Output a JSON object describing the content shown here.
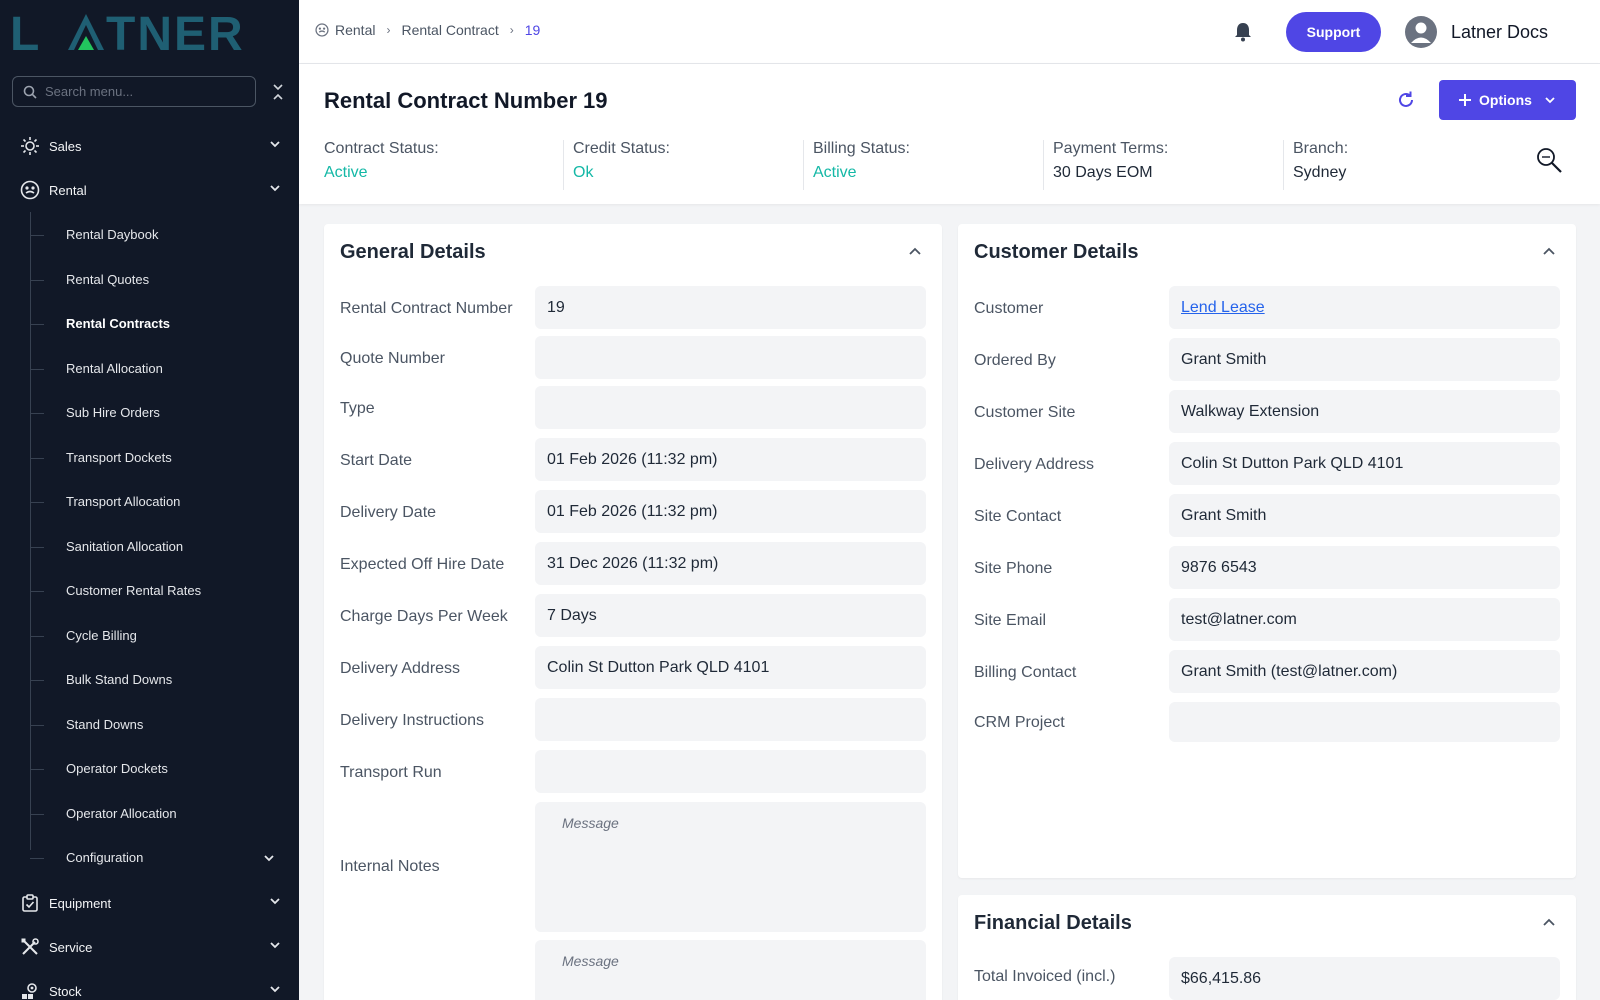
{
  "sidebar": {
    "logo_text": "LATNER",
    "search_placeholder": "Search menu...",
    "sections": {
      "sales": "Sales",
      "rental": "Rental",
      "equipment": "Equipment",
      "service": "Service",
      "stock": "Stock"
    },
    "rental_items": [
      "Rental Daybook",
      "Rental Quotes",
      "Rental Contracts",
      "Rental Allocation",
      "Sub Hire Orders",
      "Transport Dockets",
      "Transport Allocation",
      "Sanitation Allocation",
      "Customer Rental Rates",
      "Cycle Billing",
      "Bulk Stand Downs",
      "Stand Downs",
      "Operator Dockets",
      "Operator Allocation",
      "Configuration"
    ]
  },
  "header": {
    "breadcrumb": [
      "Rental",
      "Rental Contract",
      "19"
    ],
    "support_label": "Support",
    "user_name": "Latner Docs"
  },
  "title": {
    "label": "Rental Contract Number",
    "number": "19",
    "options_label": "Options"
  },
  "status": [
    {
      "key": "Contract Status:",
      "value": "Active"
    },
    {
      "key": "Credit Status:",
      "value": "Ok"
    },
    {
      "key": "Billing Status:",
      "value": "Active"
    },
    {
      "key": "Payment Terms:",
      "value": "30 Days EOM"
    },
    {
      "key": "Branch:",
      "value": "Sydney"
    }
  ],
  "general": {
    "title": "General Details",
    "rows": [
      {
        "label": "Rental Contract Number",
        "value": "19"
      },
      {
        "label": "Quote Number",
        "value": ""
      },
      {
        "label": "Type",
        "value": ""
      },
      {
        "label": "Start Date",
        "value": "01 Feb 2026 (11:32 pm)"
      },
      {
        "label": "Delivery Date",
        "value": "01 Feb 2026 (11:32 pm)"
      },
      {
        "label": "Expected Off Hire Date",
        "value": "31 Dec 2026 (11:32 pm)"
      },
      {
        "label": "Charge Days Per Week",
        "value": "7 Days"
      },
      {
        "label": "Delivery Address",
        "value": "Colin St Dutton Park QLD 4101"
      },
      {
        "label": "Delivery Instructions",
        "value": ""
      },
      {
        "label": "Transport Run",
        "value": ""
      }
    ],
    "internal_notes_label": "Internal Notes",
    "message_placeholder": "Message"
  },
  "customer": {
    "title": "Customer Details",
    "rows": [
      {
        "label": "Customer",
        "value": "Lend Lease"
      },
      {
        "label": "Ordered By",
        "value": "Grant Smith"
      },
      {
        "label": "Customer Site",
        "value": "Walkway Extension"
      },
      {
        "label": "Delivery Address",
        "value": "Colin St Dutton Park QLD 4101"
      },
      {
        "label": "Site Contact",
        "value": "Grant Smith"
      },
      {
        "label": "Site Phone",
        "value": "9876 6543"
      },
      {
        "label": "Site Email",
        "value": "test@latner.com"
      },
      {
        "label": "Billing Contact",
        "value": "Grant Smith (test@latner.com)"
      },
      {
        "label": "CRM Project",
        "value": ""
      }
    ]
  },
  "financial": {
    "title": "Financial Details",
    "rows": [
      {
        "label": "Total Invoiced (incl.)",
        "value": "$66,415.86"
      }
    ]
  },
  "colors": {
    "sidebar_bg": "#111827",
    "accent": "#4f46e5",
    "status_green": "#14b8a6",
    "logo": "#1f5f73",
    "link": "#2563eb"
  }
}
